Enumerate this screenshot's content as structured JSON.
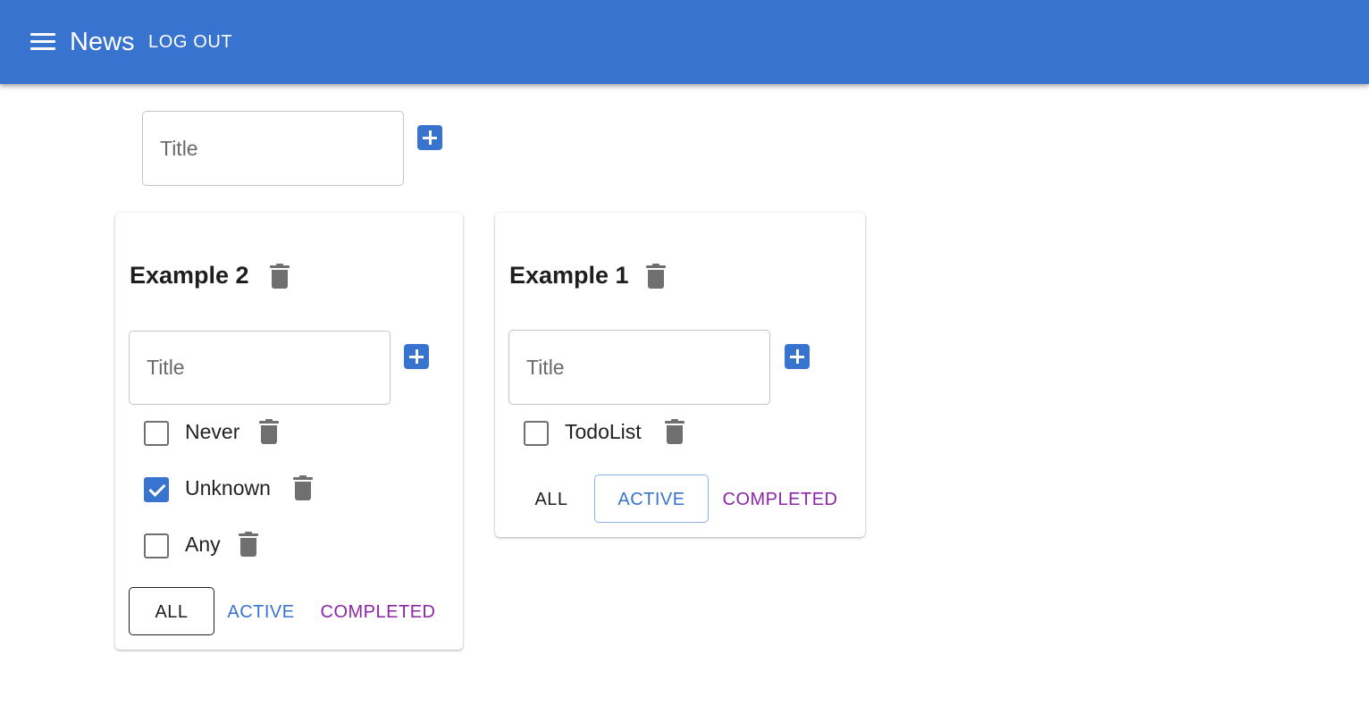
{
  "app": {
    "title": "News",
    "logout_label": "LOG OUT",
    "menu_icon": "hamburger-menu-icon",
    "brand_color": "#3874cf"
  },
  "new_list": {
    "placeholder": "Title",
    "add_icon": "add-box-icon"
  },
  "todolists": [
    {
      "title": "Example 2",
      "input_placeholder": "Title",
      "tasks": [
        {
          "label": "Never",
          "checked": false
        },
        {
          "label": "Unknown",
          "checked": true
        },
        {
          "label": "Any",
          "checked": false
        }
      ],
      "filters": {
        "all": "ALL",
        "active": "ACTIVE",
        "completed": "COMPLETED"
      },
      "selected_filter": "all"
    },
    {
      "title": "Example 1",
      "input_placeholder": "Title",
      "tasks": [
        {
          "label": "TodoList",
          "checked": false
        }
      ],
      "filters": {
        "all": "ALL",
        "active": "ACTIVE",
        "completed": "COMPLETED"
      },
      "selected_filter": "active"
    }
  ],
  "colors": {
    "active_filter": "#3874cf",
    "completed_filter": "#8e24aa",
    "icon_gray": "#6f6f6f"
  }
}
